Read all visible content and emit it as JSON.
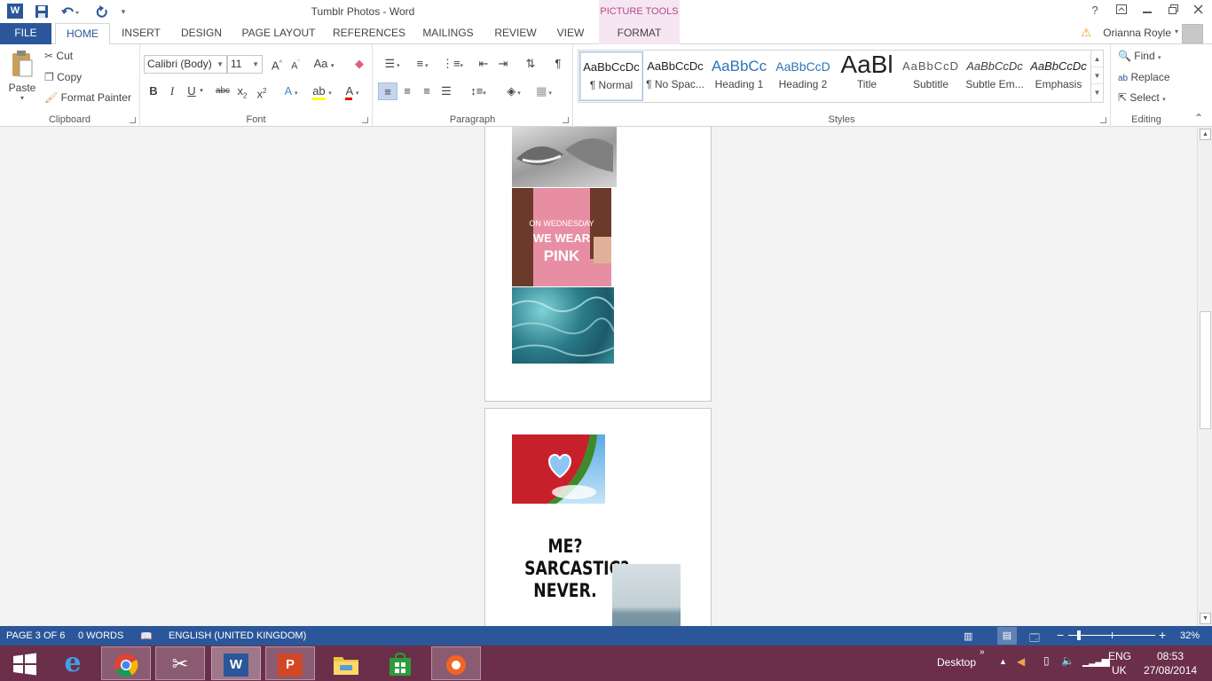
{
  "window": {
    "title": "Tumblr Photos - Word",
    "picture_tools": "PICTURE TOOLS"
  },
  "qat": {
    "word_icon": "word-app-icon",
    "save_icon": "save-icon",
    "undo_icon": "undo-icon",
    "redo_icon": "redo-icon",
    "customize_icon": "customize-qat-icon"
  },
  "window_controls": {
    "help": "?",
    "ribbon_options": "ribbon-display-icon",
    "minimize": "minimize-icon",
    "restore": "restore-icon",
    "close": "close-icon"
  },
  "tabs": [
    {
      "label": "FILE"
    },
    {
      "label": "HOME"
    },
    {
      "label": "INSERT"
    },
    {
      "label": "DESIGN"
    },
    {
      "label": "PAGE LAYOUT"
    },
    {
      "label": "REFERENCES"
    },
    {
      "label": "MAILINGS"
    },
    {
      "label": "REVIEW"
    },
    {
      "label": "VIEW"
    },
    {
      "label": "FORMAT"
    }
  ],
  "user": {
    "name": "Orianna Royle"
  },
  "clipboard": {
    "paste": "Paste",
    "cut": "Cut",
    "copy": "Copy",
    "format_painter": "Format Painter",
    "label": "Clipboard"
  },
  "font": {
    "name": "Calibri (Body)",
    "size": "11",
    "label": "Font",
    "case": "Aa"
  },
  "paragraph": {
    "label": "Paragraph"
  },
  "styles": {
    "label": "Styles",
    "items": [
      {
        "preview": "AaBbCcDc",
        "name": "¶ Normal"
      },
      {
        "preview": "AaBbCcDc",
        "name": "¶ No Spac..."
      },
      {
        "preview": "AaBbCc",
        "name": "Heading 1"
      },
      {
        "preview": "AaBbCcD",
        "name": "Heading 2"
      },
      {
        "preview": "AaBl",
        "name": "Title"
      },
      {
        "preview": "AaBbCcD",
        "name": "Subtitle"
      },
      {
        "preview": "AaBbCcDc",
        "name": "Subtle Em..."
      },
      {
        "preview": "AaBbCcDc",
        "name": "Emphasis"
      }
    ]
  },
  "editing": {
    "find": "Find",
    "replace": "Replace",
    "select": "Select",
    "label": "Editing"
  },
  "document": {
    "sarcastic_text": "ME?\nSARCASTIC?\nNEVER."
  },
  "status": {
    "page": "PAGE 3 OF 6",
    "words": "0 WORDS",
    "language": "ENGLISH (UNITED KINGDOM)",
    "zoom": "32%",
    "zoom_level": 0.32
  },
  "taskbar": {
    "apps": [
      "start-icon",
      "internet-explorer-icon",
      "chrome-icon",
      "snipping-tool-icon",
      "word-icon",
      "powerpoint-icon",
      "file-explorer-icon",
      "store-icon",
      "app-icon"
    ],
    "desktop": "Desktop",
    "lang": "ENG",
    "region": "UK",
    "time": "08:53",
    "date": "27/08/2014"
  }
}
